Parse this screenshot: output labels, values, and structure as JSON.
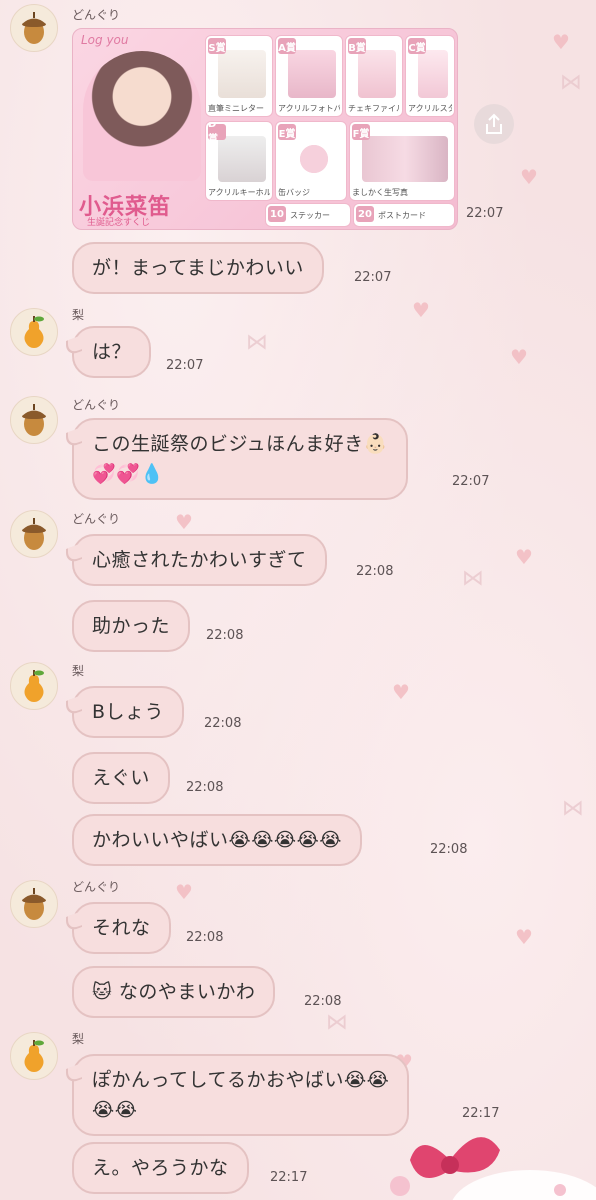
{
  "senders": {
    "donguri": "どんぐり",
    "nashi": "梨"
  },
  "card": {
    "logo": "Log you",
    "title": "小浜菜笛",
    "subtitle": "生誕記念すくじ",
    "items": [
      {
        "tag": "S賞",
        "caption": "直筆ミニレター"
      },
      {
        "tag": "A賞",
        "caption": "アクリルフォトパネル"
      },
      {
        "tag": "B賞",
        "caption": "チェキファイル"
      },
      {
        "tag": "C賞",
        "caption": "アクリルスタンド"
      },
      {
        "tag": "D賞",
        "caption": "アクリルキーホルダー"
      },
      {
        "tag": "E賞",
        "caption": "缶バッジ"
      },
      {
        "tag": "F賞",
        "caption": "ましかく生写真"
      },
      {
        "tag": "10",
        "caption": "ステッカー"
      },
      {
        "tag": "20",
        "caption": "ポストカード"
      }
    ],
    "time": "22:07"
  },
  "messages": [
    {
      "text": "が！まってまじかわいい",
      "time": "22:07"
    },
    {
      "text": "は？",
      "time": "22:07"
    },
    {
      "text": "この生誕祭のビジュほんま好き👶🏻",
      "line2": "💞💞💧",
      "time": "22:07"
    },
    {
      "text": "心癒されたかわいすぎて",
      "time": "22:08"
    },
    {
      "text": "助かった",
      "time": "22:08"
    },
    {
      "text": "Bしょう",
      "time": "22:08"
    },
    {
      "text": "えぐい",
      "time": "22:08"
    },
    {
      "text": "かわいいやばい😭😭😭😭😭",
      "time": "22:08"
    },
    {
      "text": "それな",
      "time": "22:08"
    },
    {
      "text": "🐱 なのやまいかわ",
      "time": "22:08"
    },
    {
      "text": "ぽかんってしてるかおやばい😭😭",
      "line2": "😭😭",
      "time": "22:17"
    },
    {
      "text": "え。やろうかな",
      "time": "22:17"
    }
  ],
  "icons": {
    "donguri_avatar": "acorn-icon",
    "nashi_avatar": "pear-icon",
    "share": "share-icon"
  },
  "colors": {
    "bubble": "#f7dede",
    "bubble_border": "#e4c2c2",
    "background": "#f6e2e3",
    "accent": "#e05b8e"
  }
}
